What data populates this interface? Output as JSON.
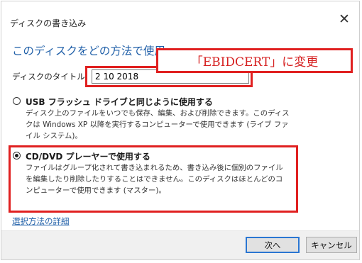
{
  "window": {
    "title": "ディスクの書き込み",
    "close_glyph": "✕"
  },
  "heading": "このディスクをどの方法で使用",
  "disc_title": {
    "label": "ディスクのタイトル:",
    "value": "2 10 2018"
  },
  "callout": {
    "text": "「EBIDCERT」に変更"
  },
  "options": [
    {
      "label": "USB フラッシュ ドライブと同じように使用する",
      "description": "ディスク上のファイルをいつでも保存、編集、および削除できます。このディスクは Windows XP 以降を実行するコンピューターで使用できます (ライブ ファイル システム)。",
      "selected": false
    },
    {
      "label": "CD/DVD プレーヤーで使用する",
      "description": "ファイルはグループ化されて書き込まれるため、書き込み後に個別のファイルを編集したり削除したりすることはできません。このディスクはほとんどのコンピューターで使用できます (マスター)。",
      "selected": true
    }
  ],
  "link": "選択方法の詳細",
  "buttons": {
    "next": "次へ",
    "cancel": "キャンセル"
  },
  "colors": {
    "accent": "#1f5fa8",
    "annotation": "#e02020"
  }
}
